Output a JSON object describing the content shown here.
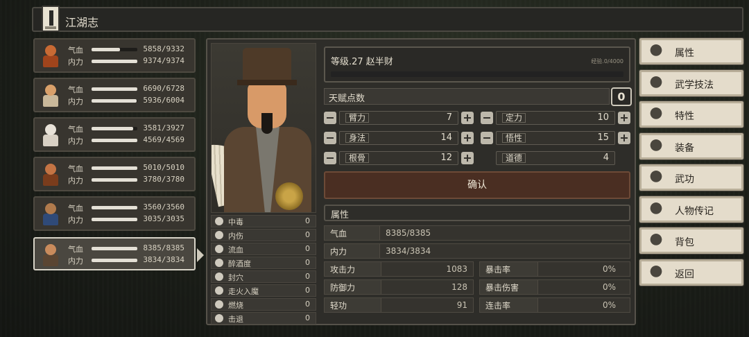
{
  "title": "江湖志",
  "party": [
    {
      "hp_label": "气血",
      "hp": "5858/9332",
      "hp_ratio": 0.628,
      "mp_label": "内力",
      "mp": "9374/9374",
      "mp_ratio": 1.0,
      "skin": "#c86a34",
      "robe": "#a0441c"
    },
    {
      "hp_label": "气血",
      "hp": "6690/6728",
      "hp_ratio": 0.994,
      "mp_label": "内力",
      "mp": "5936/6004",
      "mp_ratio": 0.989,
      "skin": "#d9a06a",
      "robe": "#c9b89a"
    },
    {
      "hp_label": "气血",
      "hp": "3581/3927",
      "hp_ratio": 0.912,
      "mp_label": "内力",
      "mp": "4569/4569",
      "mp_ratio": 1.0,
      "skin": "#e8e2d8",
      "robe": "#d8d0c4"
    },
    {
      "hp_label": "气血",
      "hp": "5010/5010",
      "hp_ratio": 1.0,
      "mp_label": "内力",
      "mp": "3780/3780",
      "mp_ratio": 1.0,
      "skin": "#c47444",
      "robe": "#7a3c1c"
    },
    {
      "hp_label": "气血",
      "hp": "3560/3560",
      "hp_ratio": 1.0,
      "mp_label": "内力",
      "mp": "3035/3035",
      "mp_ratio": 1.0,
      "skin": "#b07a4c",
      "robe": "#2f4a78"
    },
    {
      "hp_label": "气血",
      "hp": "8385/8385",
      "hp_ratio": 1.0,
      "mp_label": "内力",
      "mp": "3834/3834",
      "mp_ratio": 1.0,
      "skin": "#c98b5c",
      "robe": "#5a4532"
    }
  ],
  "character": {
    "level_line": "等级.27  赵半财",
    "exp": "经验.0/4000",
    "talent_label": "天赋点数",
    "talent_points": "0",
    "attributes": [
      {
        "name": "臂力",
        "value": "7",
        "plus": true
      },
      {
        "name": "定力",
        "value": "10",
        "plus": true
      },
      {
        "name": "身法",
        "value": "14",
        "plus": true
      },
      {
        "name": "悟性",
        "value": "15",
        "plus": true
      },
      {
        "name": "根骨",
        "value": "12",
        "plus": true
      },
      {
        "name": "道德",
        "value": "4",
        "plus": false
      }
    ],
    "confirm": "确认",
    "props_title": "属性",
    "hp_label": "气血",
    "hp": "8385/8385",
    "mp_label": "内力",
    "mp": "3834/3834",
    "combat": [
      {
        "label": "攻击力",
        "value": "1083",
        "label2": "暴击率",
        "value2": "0%"
      },
      {
        "label": "防御力",
        "value": "128",
        "label2": "暴击伤害",
        "value2": "0%"
      },
      {
        "label": "轻功",
        "value": "91",
        "label2": "连击率",
        "value2": "0%"
      }
    ],
    "effects": [
      {
        "label": "中毒",
        "value": "0"
      },
      {
        "label": "内伤",
        "value": "0"
      },
      {
        "label": "流血",
        "value": "0"
      },
      {
        "label": "醉酒度",
        "value": "0"
      },
      {
        "label": "封穴",
        "value": "0"
      },
      {
        "label": "走火入魔",
        "value": "0"
      },
      {
        "label": "燃烧",
        "value": "0"
      },
      {
        "label": "击退",
        "value": "0"
      }
    ]
  },
  "menu": [
    {
      "label": "属性",
      "icon": "person-icon"
    },
    {
      "label": "武学技法",
      "icon": "martial-arts-icon"
    },
    {
      "label": "特性",
      "icon": "trait-icon"
    },
    {
      "label": "装备",
      "icon": "sword-icon"
    },
    {
      "label": "武功",
      "icon": "book-icon"
    },
    {
      "label": "人物传记",
      "icon": "biography-icon"
    },
    {
      "label": "背包",
      "icon": "bag-icon"
    },
    {
      "label": "返回",
      "icon": "door-icon"
    }
  ]
}
